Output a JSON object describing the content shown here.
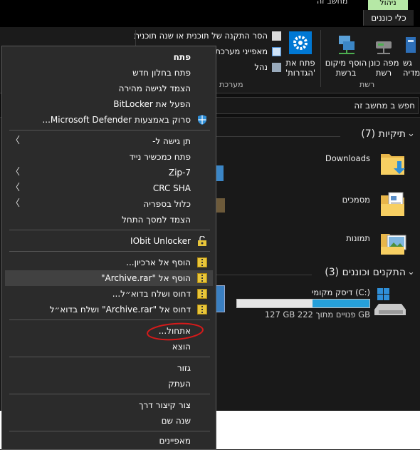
{
  "ribbon": {
    "tab_manage": "ניהול",
    "tab_previous": "מחשב זה",
    "tab_tools": "כלי כוננים",
    "network_group_label": "רשת",
    "system_group_label": "מערכת",
    "btn_add_location": [
      "הוסף מיקום",
      "ברשת"
    ],
    "btn_map_drive": [
      "מפה כונן",
      "רשת"
    ],
    "btn_media": [
      "גש",
      "מדיה"
    ],
    "btn_open_settings": [
      "פתח את",
      "'הגדרות'"
    ],
    "cmd_uninstall": "הסר התקנה של תוכנית או שנה תוכנית",
    "cmd_system_props": "מאפייני מערכת",
    "cmd_manage": "נהל"
  },
  "address": {
    "search_placeholder": "חפש ב מחשב זה"
  },
  "folders": {
    "header": "תיקיות (7)",
    "items": [
      {
        "name": "Downloads",
        "icon": "downloads-folder-icon"
      },
      {
        "name": "מסמכים",
        "icon": "documents-folder-icon"
      },
      {
        "name": "תמונות",
        "icon": "pictures-folder-icon"
      }
    ]
  },
  "devices": {
    "header": "התקנים וכוננים (3)",
    "drive_name": "דיסק מקומי (C:)",
    "drive_free": "127 GB פנויים מתוך 222 GB",
    "drive_usage_fraction": 0.43
  },
  "context_menu": {
    "items": [
      {
        "label": "פתח",
        "bold": true
      },
      {
        "label": "פתח בחלון חדש"
      },
      {
        "label": "הצמד לגישה מהירה"
      },
      {
        "label": "הפעל את BitLocker"
      },
      {
        "label": "סרוק באמצעות Microsoft Defender..."
      },
      {
        "label": "תן גישה ל-"
      },
      {
        "label": "פתח כמכשיר נייד"
      },
      {
        "label": "7-Zip"
      },
      {
        "label": "CRC SHA"
      },
      {
        "label": "כלול בספריה"
      },
      {
        "label": "הצמד למסך התחל"
      },
      {
        "label": "IObit Unlocker"
      },
      {
        "label": "הוסף אל ארכיון..."
      },
      {
        "label": "הוסף אל \"Archive.rar\""
      },
      {
        "label": "דחוס ושלח בדוא״ל..."
      },
      {
        "label": "דחוס אל \"Archive.rar\" ושלח בדוא״ל"
      },
      {
        "label": "אתחול..."
      },
      {
        "label": "הוצא"
      },
      {
        "label": "גזור"
      },
      {
        "label": "העתק"
      },
      {
        "label": "צור קיצור דרך"
      },
      {
        "label": "שנה שם"
      },
      {
        "label": "מאפיינים"
      }
    ]
  }
}
